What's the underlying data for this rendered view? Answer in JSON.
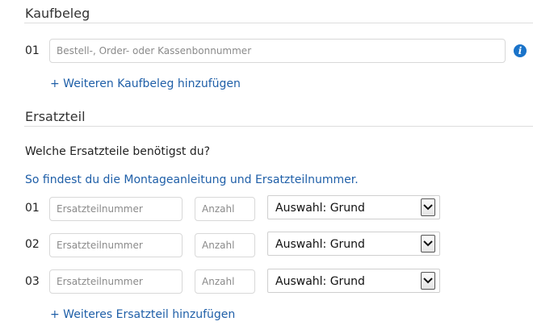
{
  "receipt_section": {
    "title": "Kaufbeleg",
    "row_number": "01",
    "input_placeholder": "Bestell-, Order- oder Kassenbonnummer",
    "info_icon_glyph": "i",
    "add_link": "+ Weiteren Kaufbeleg hinzufügen"
  },
  "spare_part_section": {
    "title": "Ersatzteil",
    "question": "Welche Ersatzteile benötigst du?",
    "help_link": "So findest du die Montageanleitung und Ersatzteilnummer.",
    "rows": [
      {
        "number": "01",
        "part_placeholder": "Ersatzteilnummer",
        "quantity_placeholder": "Anzahl",
        "reason_value": "Auswahl: Grund"
      },
      {
        "number": "02",
        "part_placeholder": "Ersatzteilnummer",
        "quantity_placeholder": "Anzahl",
        "reason_value": "Auswahl: Grund"
      },
      {
        "number": "03",
        "part_placeholder": "Ersatzteilnummer",
        "quantity_placeholder": "Anzahl",
        "reason_value": "Auswahl: Grund"
      }
    ],
    "add_link": "+ Weiteres Ersatzteil hinzufügen"
  },
  "colors": {
    "link": "#1f5fa8",
    "info_icon": "#1a73c9",
    "divider": "#dddddd"
  }
}
